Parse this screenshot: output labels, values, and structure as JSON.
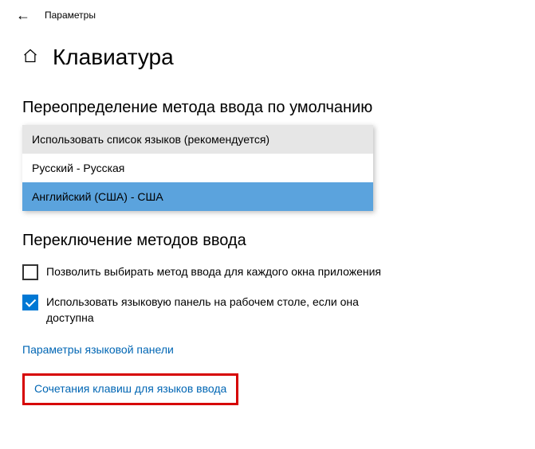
{
  "header": {
    "breadcrumb": "Параметры"
  },
  "page": {
    "title": "Клавиатура"
  },
  "sections": {
    "override": {
      "title": "Переопределение метода ввода по умолчанию",
      "options": [
        "Использовать список языков (рекомендуется)",
        "Русский - Русская",
        "Английский (США) - США"
      ]
    },
    "switching": {
      "title": "Переключение методов ввода",
      "checkbox1": "Позволить выбирать метод ввода для каждого окна приложения",
      "checkbox2": "Использовать языковую панель на рабочем столе, если она доступна"
    },
    "links": {
      "lang_panel": "Параметры языковой панели",
      "hotkeys": "Сочетания клавиш для языков ввода"
    }
  }
}
